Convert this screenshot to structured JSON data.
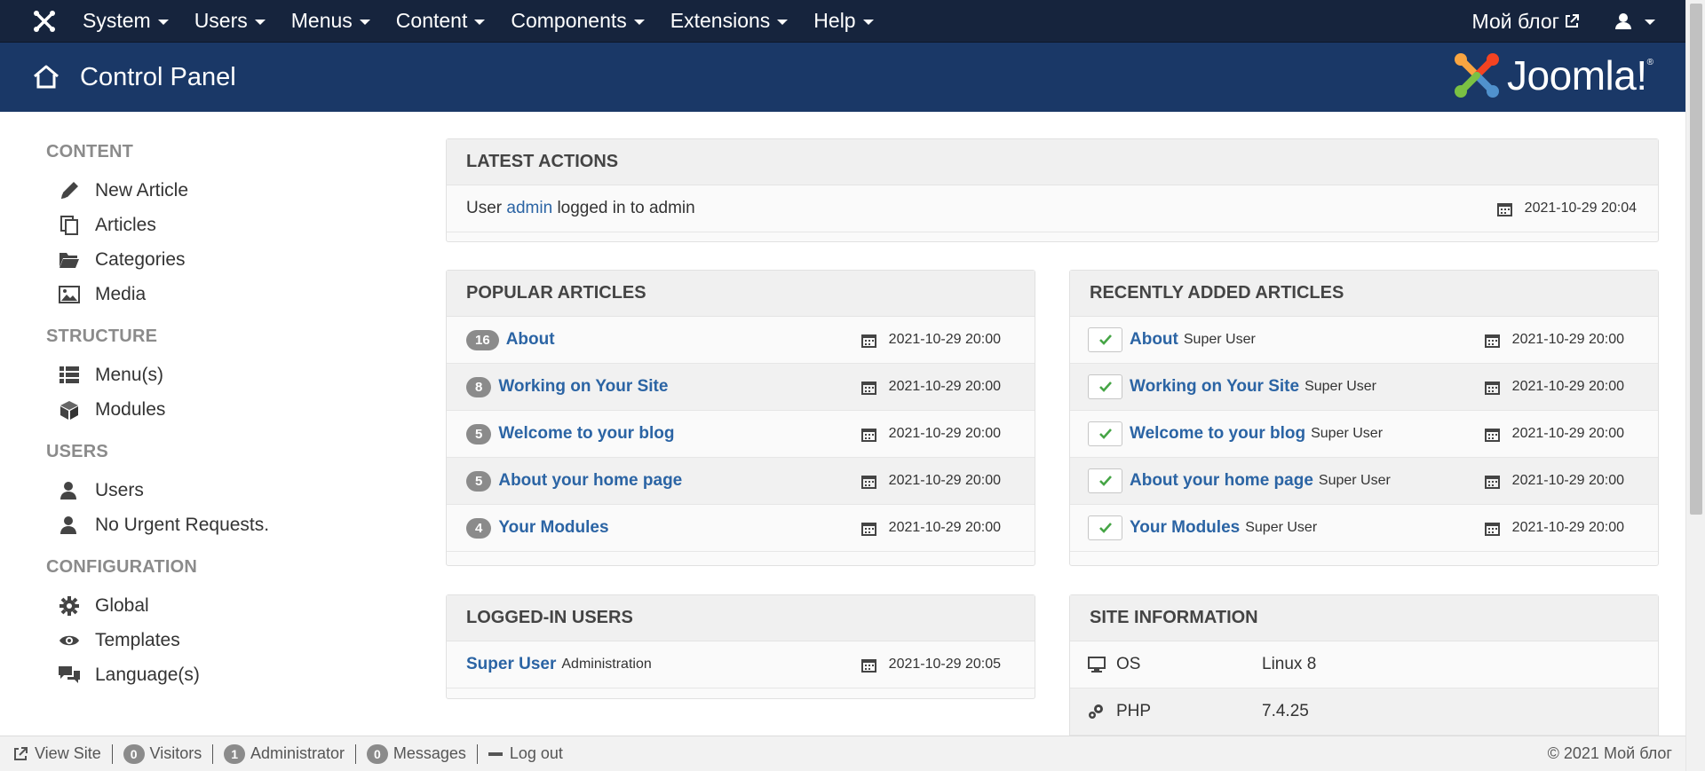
{
  "topnav": {
    "menus": [
      "System",
      "Users",
      "Menus",
      "Content",
      "Components",
      "Extensions",
      "Help"
    ],
    "site_name": "Мой блог"
  },
  "header": {
    "title": "Control Panel",
    "brand": "Joomla!",
    "brand_mark": "®"
  },
  "sidebar": {
    "groups": [
      {
        "heading": "CONTENT",
        "items": [
          {
            "label": "New Article",
            "icon": "pencil-icon"
          },
          {
            "label": "Articles",
            "icon": "copy-icon"
          },
          {
            "label": "Categories",
            "icon": "folder-open-icon"
          },
          {
            "label": "Media",
            "icon": "image-icon"
          }
        ]
      },
      {
        "heading": "STRUCTURE",
        "items": [
          {
            "label": "Menu(s)",
            "icon": "list-icon"
          },
          {
            "label": "Modules",
            "icon": "cube-icon"
          }
        ]
      },
      {
        "heading": "USERS",
        "items": [
          {
            "label": "Users",
            "icon": "user-icon"
          },
          {
            "label": "No Urgent Requests.",
            "icon": "user-icon"
          }
        ]
      },
      {
        "heading": "CONFIGURATION",
        "items": [
          {
            "label": "Global",
            "icon": "cog-icon"
          },
          {
            "label": "Templates",
            "icon": "eye-icon"
          },
          {
            "label": "Language(s)",
            "icon": "comments-icon"
          }
        ]
      }
    ]
  },
  "latest_actions": {
    "heading": "LATEST ACTIONS",
    "rows": [
      {
        "prefix": "User",
        "user": "admin",
        "suffix": "logged in to admin",
        "date": "2021-10-29 20:04"
      }
    ]
  },
  "popular_articles": {
    "heading": "POPULAR ARTICLES",
    "rows": [
      {
        "hits": "16",
        "title": "About",
        "date": "2021-10-29 20:00"
      },
      {
        "hits": "8",
        "title": "Working on Your Site",
        "date": "2021-10-29 20:00"
      },
      {
        "hits": "5",
        "title": "Welcome to your blog",
        "date": "2021-10-29 20:00"
      },
      {
        "hits": "5",
        "title": "About your home page",
        "date": "2021-10-29 20:00"
      },
      {
        "hits": "4",
        "title": "Your Modules",
        "date": "2021-10-29 20:00"
      }
    ]
  },
  "recent_articles": {
    "heading": "RECENTLY ADDED ARTICLES",
    "rows": [
      {
        "title": "About",
        "author": "Super User",
        "date": "2021-10-29 20:00"
      },
      {
        "title": "Working on Your Site",
        "author": "Super User",
        "date": "2021-10-29 20:00"
      },
      {
        "title": "Welcome to your blog",
        "author": "Super User",
        "date": "2021-10-29 20:00"
      },
      {
        "title": "About your home page",
        "author": "Super User",
        "date": "2021-10-29 20:00"
      },
      {
        "title": "Your Modules",
        "author": "Super User",
        "date": "2021-10-29 20:00"
      }
    ]
  },
  "logged_in_users": {
    "heading": "LOGGED-IN USERS",
    "rows": [
      {
        "name": "Super User",
        "area": "Administration",
        "date": "2021-10-29 20:05"
      }
    ]
  },
  "site_information": {
    "heading": "SITE INFORMATION",
    "rows": [
      {
        "label": "OS",
        "value": "Linux 8",
        "icon": "desktop-icon"
      },
      {
        "label": "PHP",
        "value": "7.4.25",
        "icon": "cogs-icon"
      }
    ]
  },
  "statusbar": {
    "view_site": "View Site",
    "visitors_count": "0",
    "visitors_label": "Visitors",
    "admins_count": "1",
    "admins_label": "Administrator",
    "messages_count": "0",
    "messages_label": "Messages",
    "logout": "Log out",
    "copyright": "© 2021 Мой блог"
  },
  "colors": {
    "topnav_bg": "#16243d",
    "header_bg": "#1a3867",
    "link": "#2b64a4",
    "badge": "#8b8b8b",
    "check_green": "#46a546"
  }
}
